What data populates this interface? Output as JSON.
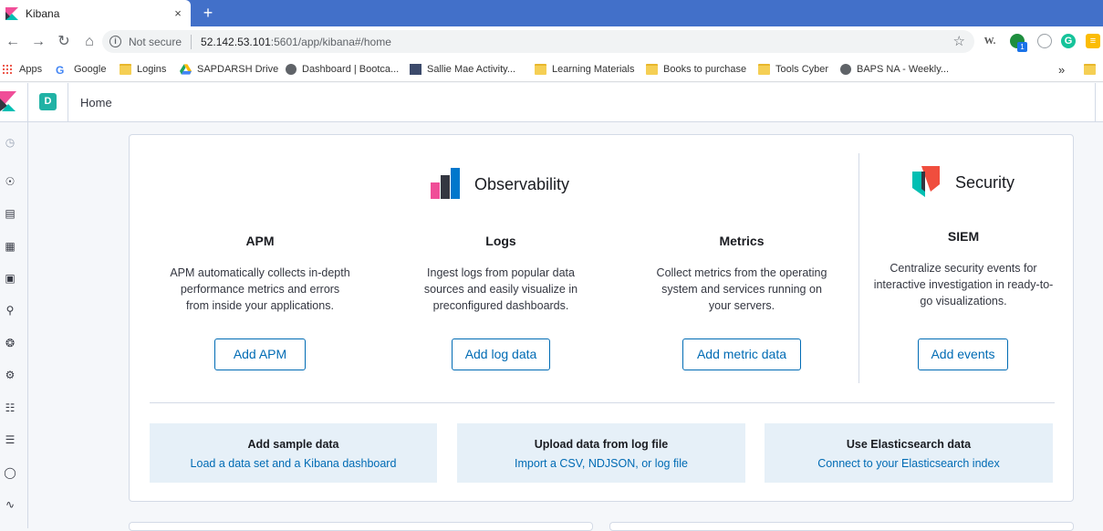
{
  "browser": {
    "tab_title": "Kibana",
    "tab_close": "×",
    "new_tab": "+",
    "security_label": "Not secure",
    "url_host": "52.142.53.101",
    "url_path": ":5601/app/kibana#/home",
    "bookmarks": [
      "Apps",
      "Google",
      "Logins",
      "SAPDARSH Drive",
      "Dashboard | Bootca...",
      "Sallie Mae Activity...",
      "Learning Materials",
      "Books to purchase",
      "Tools Cyber",
      "BAPS NA - Weekly..."
    ],
    "bookmarks_overflow": "»",
    "extension_badge": "1"
  },
  "header": {
    "space_initial": "D",
    "breadcrumb": "Home"
  },
  "observability": {
    "title": "Observability",
    "solutions": [
      {
        "title": "APM",
        "description": "APM automatically collects in-depth performance metrics and errors from inside your applications.",
        "button": "Add APM"
      },
      {
        "title": "Logs",
        "description": "Ingest logs from popular data sources and easily visualize in preconfigured dashboards.",
        "button": "Add log data"
      },
      {
        "title": "Metrics",
        "description": "Collect metrics from the operating system and services running on your servers.",
        "button": "Add metric data"
      }
    ]
  },
  "security": {
    "title": "Security",
    "solution": {
      "title": "SIEM",
      "description": "Centralize security events for interactive investigation in ready-to-go visualizations.",
      "button": "Add events"
    }
  },
  "cards": [
    {
      "title": "Add sample data",
      "link": "Load a data set and a Kibana dashboard"
    },
    {
      "title": "Upload data from log file",
      "link": "Import a CSV, NDJSON, or log file"
    },
    {
      "title": "Use Elasticsearch data",
      "link": "Connect to your Elasticsearch index"
    }
  ],
  "colors": {
    "accent": "#006bb4",
    "card_bg": "#e6f0f8",
    "space_avatar": "#20b2a5",
    "tabstrip": "#4270c9"
  }
}
